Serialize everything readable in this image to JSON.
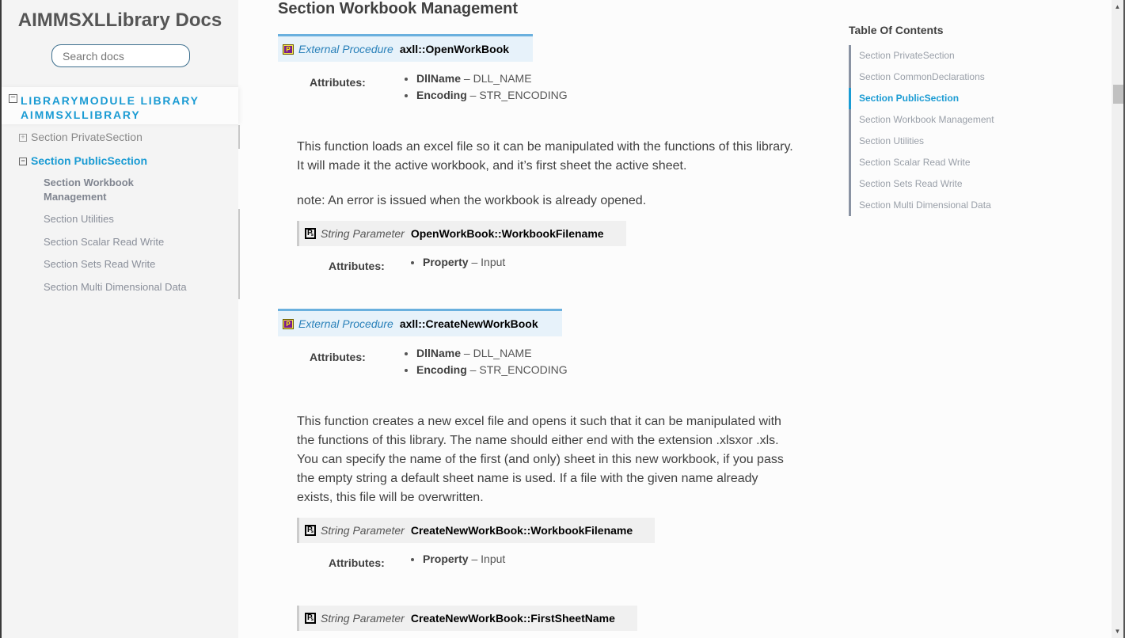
{
  "sidebar": {
    "title": "AIMMSXLLibrary Docs",
    "search_placeholder": "Search docs",
    "root": {
      "toggle": "⊟",
      "label": "LIBRARYMODULE LIBRARY AIMMSXLLIBRARY"
    },
    "items": [
      {
        "toggle": "+",
        "label": "Section PrivateSection"
      },
      {
        "toggle": "−",
        "label": "Section PublicSection"
      }
    ],
    "subitems": [
      {
        "label": "Section Workbook Management"
      },
      {
        "label": "Section Utilities"
      },
      {
        "label": "Section Scalar Read Write"
      },
      {
        "label": "Section Sets Read Write"
      },
      {
        "label": "Section Multi Dimensional Data"
      }
    ]
  },
  "main": {
    "section_title": "Section Workbook Management",
    "procedures": [
      {
        "kind": "External Procedure",
        "name": "axll::OpenWorkBook",
        "attributes_label": "Attributes:",
        "attributes": [
          {
            "key": "DllName",
            "value": "DLL_NAME"
          },
          {
            "key": "Encoding",
            "value": "STR_ENCODING"
          }
        ],
        "paragraphs": [
          "This function loads an excel file so it can be manipulated with the functions of this library. It will made it the active workbook, and it’s first sheet the active sheet.",
          "note: An error is issued when the workbook is already opened."
        ],
        "parameters": [
          {
            "kind": "String Parameter",
            "name": "OpenWorkBook::WorkbookFilename",
            "attributes_label": "Attributes:",
            "attributes": [
              {
                "key": "Property",
                "value": "Input"
              }
            ]
          }
        ]
      },
      {
        "kind": "External Procedure",
        "name": "axll::CreateNewWorkBook",
        "attributes_label": "Attributes:",
        "attributes": [
          {
            "key": "DllName",
            "value": "DLL_NAME"
          },
          {
            "key": "Encoding",
            "value": "STR_ENCODING"
          }
        ],
        "paragraphs": [
          "This function creates a new excel file and opens it such that it can be manipulated with the functions of this library. The name should either end with the extension .xlsxor .xls. You can specify the name of the first (and only) sheet in this new workbook, if you pass the empty string a default sheet name is used. If a file with the given name already exists, this file will be overwritten."
        ],
        "parameters": [
          {
            "kind": "String Parameter",
            "name": "CreateNewWorkBook::WorkbookFilename",
            "attributes_label": "Attributes:",
            "attributes": [
              {
                "key": "Property",
                "value": "Input"
              }
            ]
          },
          {
            "kind": "String Parameter",
            "name": "CreateNewWorkBook::FirstSheetName"
          }
        ]
      }
    ],
    "dash": "–"
  },
  "toc": {
    "title": "Table Of Contents",
    "items": [
      {
        "label": "Section PrivateSection",
        "active": false
      },
      {
        "label": "Section CommonDeclarations",
        "active": false
      },
      {
        "label": "Section PublicSection",
        "active": true
      },
      {
        "label": "Section Workbook Management",
        "active": false
      },
      {
        "label": "Section Utilities",
        "active": false
      },
      {
        "label": "Section Scalar Read Write",
        "active": false
      },
      {
        "label": "Section Sets Read Write",
        "active": false
      },
      {
        "label": "Section Multi Dimensional Data",
        "active": false
      }
    ]
  },
  "colors": {
    "accent": "#1a9bd3",
    "procedure_header_bg": "#e7f2fa",
    "procedure_header_border": "#6ab0de",
    "parameter_header_bg": "#f0f0f0"
  },
  "scrollbar": {
    "position_fraction": 0.14
  }
}
